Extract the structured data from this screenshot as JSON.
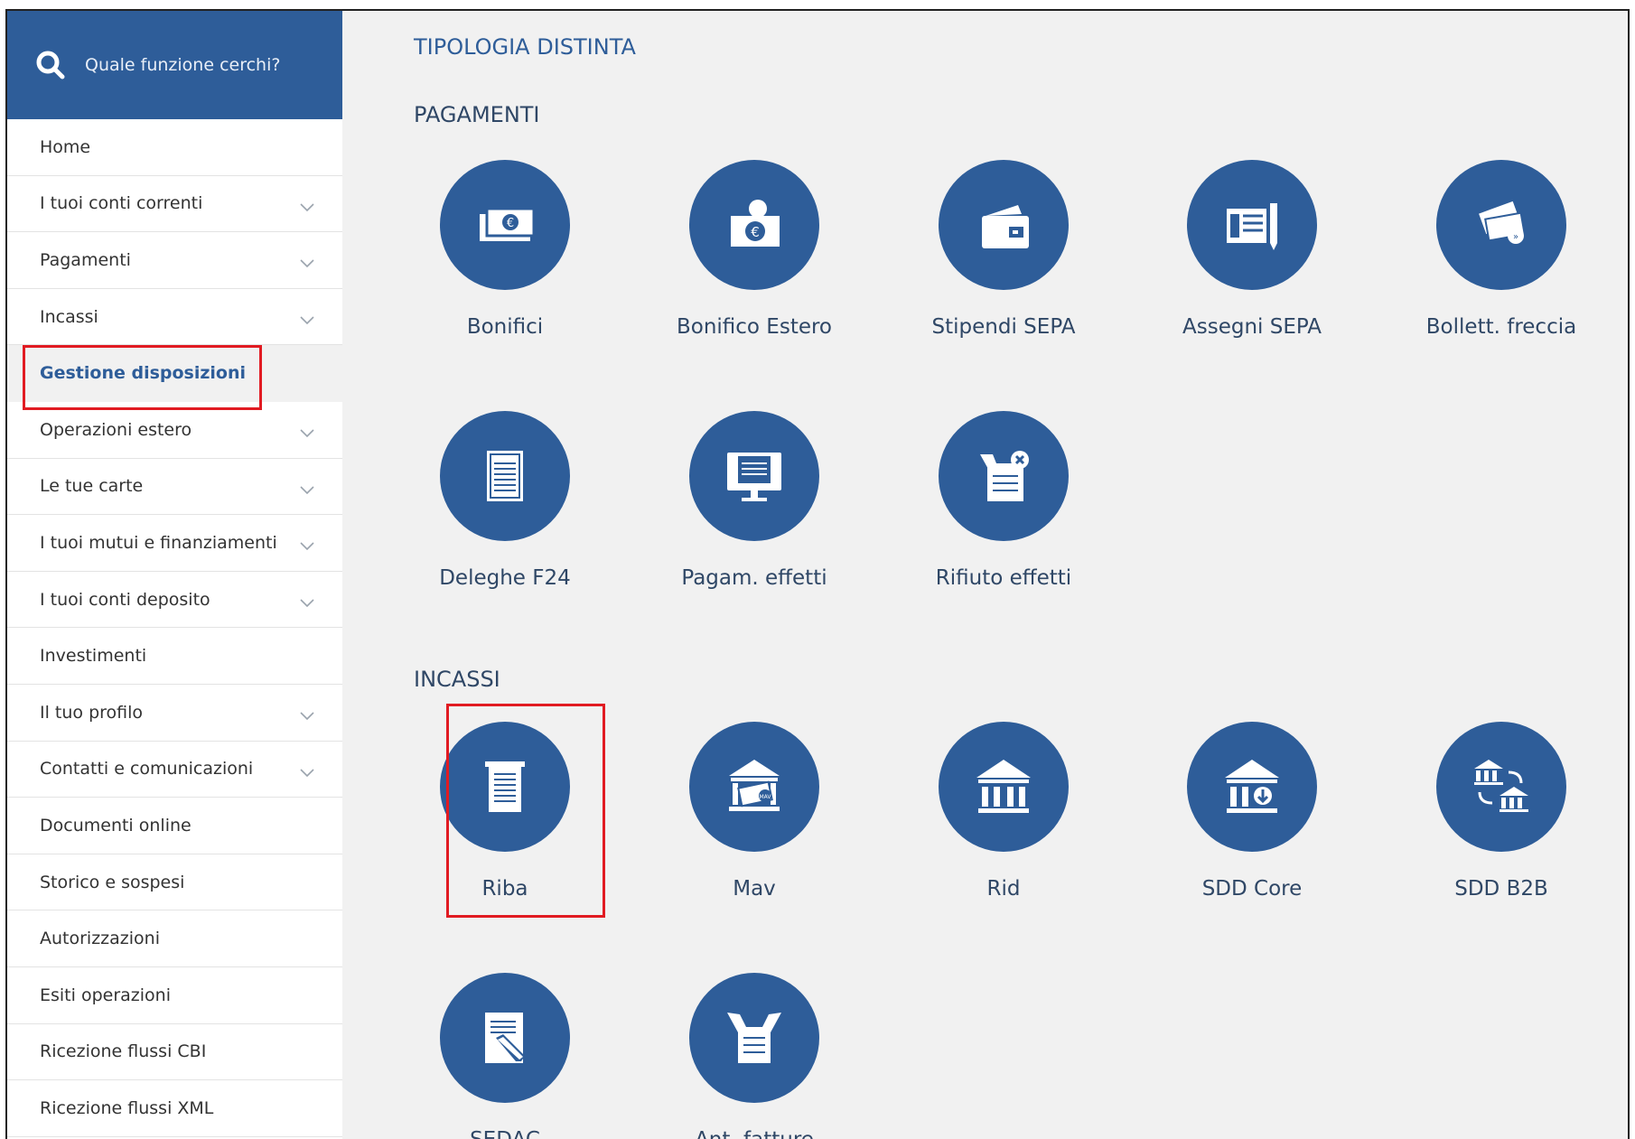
{
  "search": {
    "placeholder": "Quale funzione cerchi?"
  },
  "sidebar": {
    "items": [
      {
        "label": "Home",
        "has_chevron": false
      },
      {
        "label": "I tuoi conti correnti",
        "has_chevron": true
      },
      {
        "label": "Pagamenti",
        "has_chevron": true
      },
      {
        "label": "Incassi",
        "has_chevron": true
      },
      {
        "label": "Gestione disposizioni",
        "has_chevron": false,
        "active": true
      },
      {
        "label": "Operazioni estero",
        "has_chevron": true
      },
      {
        "label": "Le tue carte",
        "has_chevron": true
      },
      {
        "label": "I tuoi mutui e finanziamenti",
        "has_chevron": true
      },
      {
        "label": "I tuoi conti deposito",
        "has_chevron": true
      },
      {
        "label": "Investimenti",
        "has_chevron": false
      },
      {
        "label": "Il tuo profilo",
        "has_chevron": true
      },
      {
        "label": "Contatti e comunicazioni",
        "has_chevron": true
      },
      {
        "label": "Documenti online",
        "has_chevron": false
      },
      {
        "label": "Storico e sospesi",
        "has_chevron": false
      },
      {
        "label": "Autorizzazioni",
        "has_chevron": false
      },
      {
        "label": "Esiti operazioni",
        "has_chevron": false
      },
      {
        "label": "Ricezione flussi CBI",
        "has_chevron": false
      },
      {
        "label": "Ricezione flussi XML",
        "has_chevron": false
      }
    ]
  },
  "main": {
    "title": "TIPOLOGIA DISTINTA",
    "pagamenti": {
      "heading": "PAGAMENTI",
      "tiles": [
        {
          "label": "Bonifici",
          "icon": "banknotes-euro-icon"
        },
        {
          "label": "Bonifico Estero",
          "icon": "banknote-globe-icon"
        },
        {
          "label": "Stipendi SEPA",
          "icon": "wallet-icon"
        },
        {
          "label": "Assegni SEPA",
          "icon": "cheque-pen-icon"
        },
        {
          "label": "Bollett. freccia",
          "icon": "bill-arrow-icon"
        },
        {
          "label": "Deleghe F24",
          "icon": "tax-form-icon"
        },
        {
          "label": "Pagam. effetti",
          "icon": "monitor-document-icon"
        },
        {
          "label": "Rifiuto effetti",
          "icon": "reject-document-icon"
        }
      ]
    },
    "incassi": {
      "heading": "INCASSI",
      "tiles": [
        {
          "label": "Riba",
          "icon": "receipt-icon"
        },
        {
          "label": "Mav",
          "icon": "bank-mav-icon"
        },
        {
          "label": "Rid",
          "icon": "bank-icon"
        },
        {
          "label": "SDD Core",
          "icon": "bank-download-icon"
        },
        {
          "label": "SDD B2B",
          "icon": "bank-transfer-icon"
        },
        {
          "label": "SEDAC",
          "icon": "document-pencil-icon"
        },
        {
          "label": "Ant. fatture",
          "icon": "hands-document-icon"
        }
      ]
    }
  },
  "colors": {
    "brand": "#2e5d99",
    "highlight": "#e11b22",
    "background": "#f1f1f1"
  }
}
